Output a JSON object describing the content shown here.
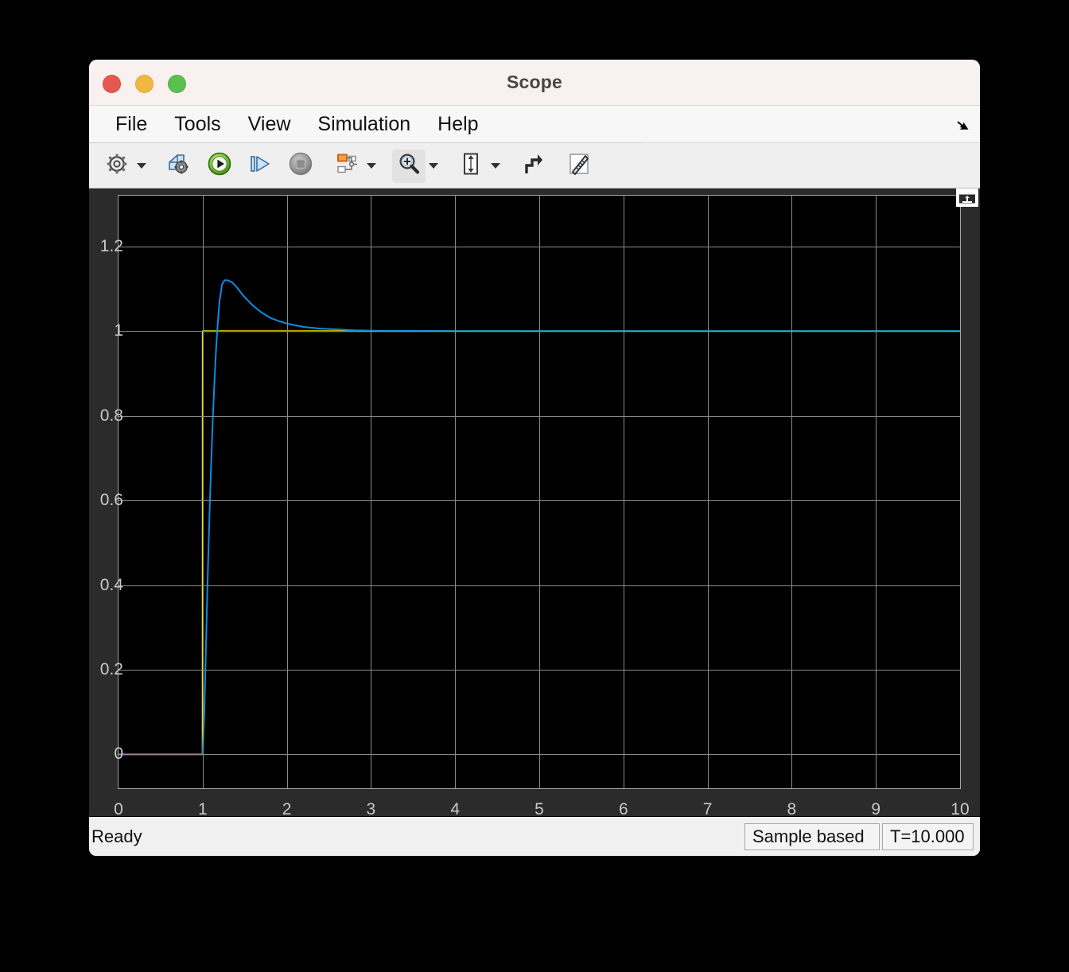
{
  "window": {
    "title": "Scope",
    "traffic_lights": [
      {
        "name": "close",
        "color": "#e5584f"
      },
      {
        "name": "minimize",
        "color": "#eeb93e"
      },
      {
        "name": "zoom",
        "color": "#5cc04e"
      }
    ]
  },
  "menubar": {
    "items": [
      {
        "label": "File"
      },
      {
        "label": "Tools"
      },
      {
        "label": "View"
      },
      {
        "label": "Simulation"
      },
      {
        "label": "Help"
      }
    ],
    "undock_icon": "undock-arrow-icon"
  },
  "toolbar": {
    "buttons": [
      {
        "name": "configuration-properties",
        "icon": "gear-icon",
        "has_caret": true,
        "active": false
      },
      {
        "name": "print",
        "icon": "print-gear-icon",
        "has_caret": false,
        "active": false
      },
      {
        "name": "run",
        "icon": "play-icon",
        "has_caret": false,
        "active": false
      },
      {
        "name": "step-forward",
        "icon": "step-forward-icon",
        "has_caret": false,
        "active": false
      },
      {
        "name": "stop",
        "icon": "stop-icon",
        "has_caret": false,
        "active": false
      },
      {
        "name": "signal-selection",
        "icon": "signal-selector-icon",
        "has_caret": true,
        "active": false
      },
      {
        "name": "zoom-in",
        "icon": "magnifier-plus-icon",
        "has_caret": true,
        "active": true
      },
      {
        "name": "autoscale",
        "icon": "autoscale-icon",
        "has_caret": true,
        "active": false
      },
      {
        "name": "scale-axes-limits",
        "icon": "axes-scale-icon",
        "has_caret": false,
        "active": false
      },
      {
        "name": "cursor-measurements",
        "icon": "ruler-icon",
        "has_caret": false,
        "active": false
      }
    ]
  },
  "scope": {
    "maximize_axes_icon": "maximize-axes-icon"
  },
  "statusbar": {
    "message": "Ready",
    "sample_mode": "Sample based",
    "simulation_time": "T=10.000"
  },
  "chart_data": {
    "type": "line",
    "title": "",
    "xlabel": "",
    "ylabel": "",
    "xlim": [
      0,
      10
    ],
    "ylim": [
      -0.08,
      1.32
    ],
    "grid": true,
    "legend": "none",
    "background": "#000000",
    "grid_color": "#8a8a8a",
    "xticks": [
      0,
      1,
      2,
      3,
      4,
      5,
      6,
      7,
      8,
      9,
      10
    ],
    "xtick_labels": [
      "0",
      "1",
      "2",
      "3",
      "4",
      "5",
      "6",
      "7",
      "8",
      "9",
      "10"
    ],
    "yticks": [
      0,
      0.2,
      0.4,
      0.6,
      0.8,
      1,
      1.2
    ],
    "ytick_labels": [
      "0",
      "0.2",
      "0.4",
      "0.6",
      "0.8",
      "1",
      "1.2"
    ],
    "series": [
      {
        "name": "reference-step",
        "color": "#EDE000",
        "width": 2,
        "points": [
          [
            0,
            0
          ],
          [
            0.999,
            0
          ],
          [
            1.0,
            1
          ],
          [
            10,
            1
          ]
        ]
      },
      {
        "name": "system-response",
        "color": "#0C8CE0",
        "width": 2,
        "points": [
          [
            0,
            0
          ],
          [
            1.0,
            0
          ],
          [
            1.02,
            0.1
          ],
          [
            1.04,
            0.26
          ],
          [
            1.06,
            0.42
          ],
          [
            1.08,
            0.56
          ],
          [
            1.1,
            0.68
          ],
          [
            1.12,
            0.79
          ],
          [
            1.14,
            0.88
          ],
          [
            1.16,
            0.96
          ],
          [
            1.18,
            1.02
          ],
          [
            1.2,
            1.07
          ],
          [
            1.23,
            1.11
          ],
          [
            1.26,
            1.12
          ],
          [
            1.3,
            1.12
          ],
          [
            1.35,
            1.115
          ],
          [
            1.4,
            1.105
          ],
          [
            1.45,
            1.092
          ],
          [
            1.5,
            1.08
          ],
          [
            1.6,
            1.06
          ],
          [
            1.7,
            1.044
          ],
          [
            1.8,
            1.032
          ],
          [
            1.9,
            1.024
          ],
          [
            2.0,
            1.018
          ],
          [
            2.2,
            1.01
          ],
          [
            2.4,
            1.006
          ],
          [
            2.6,
            1.004
          ],
          [
            2.8,
            1.002
          ],
          [
            3.0,
            1.001
          ],
          [
            3.5,
            1.0005
          ],
          [
            4.0,
            1.0
          ],
          [
            6.0,
            1.0
          ],
          [
            10.0,
            1.0
          ]
        ]
      }
    ]
  }
}
